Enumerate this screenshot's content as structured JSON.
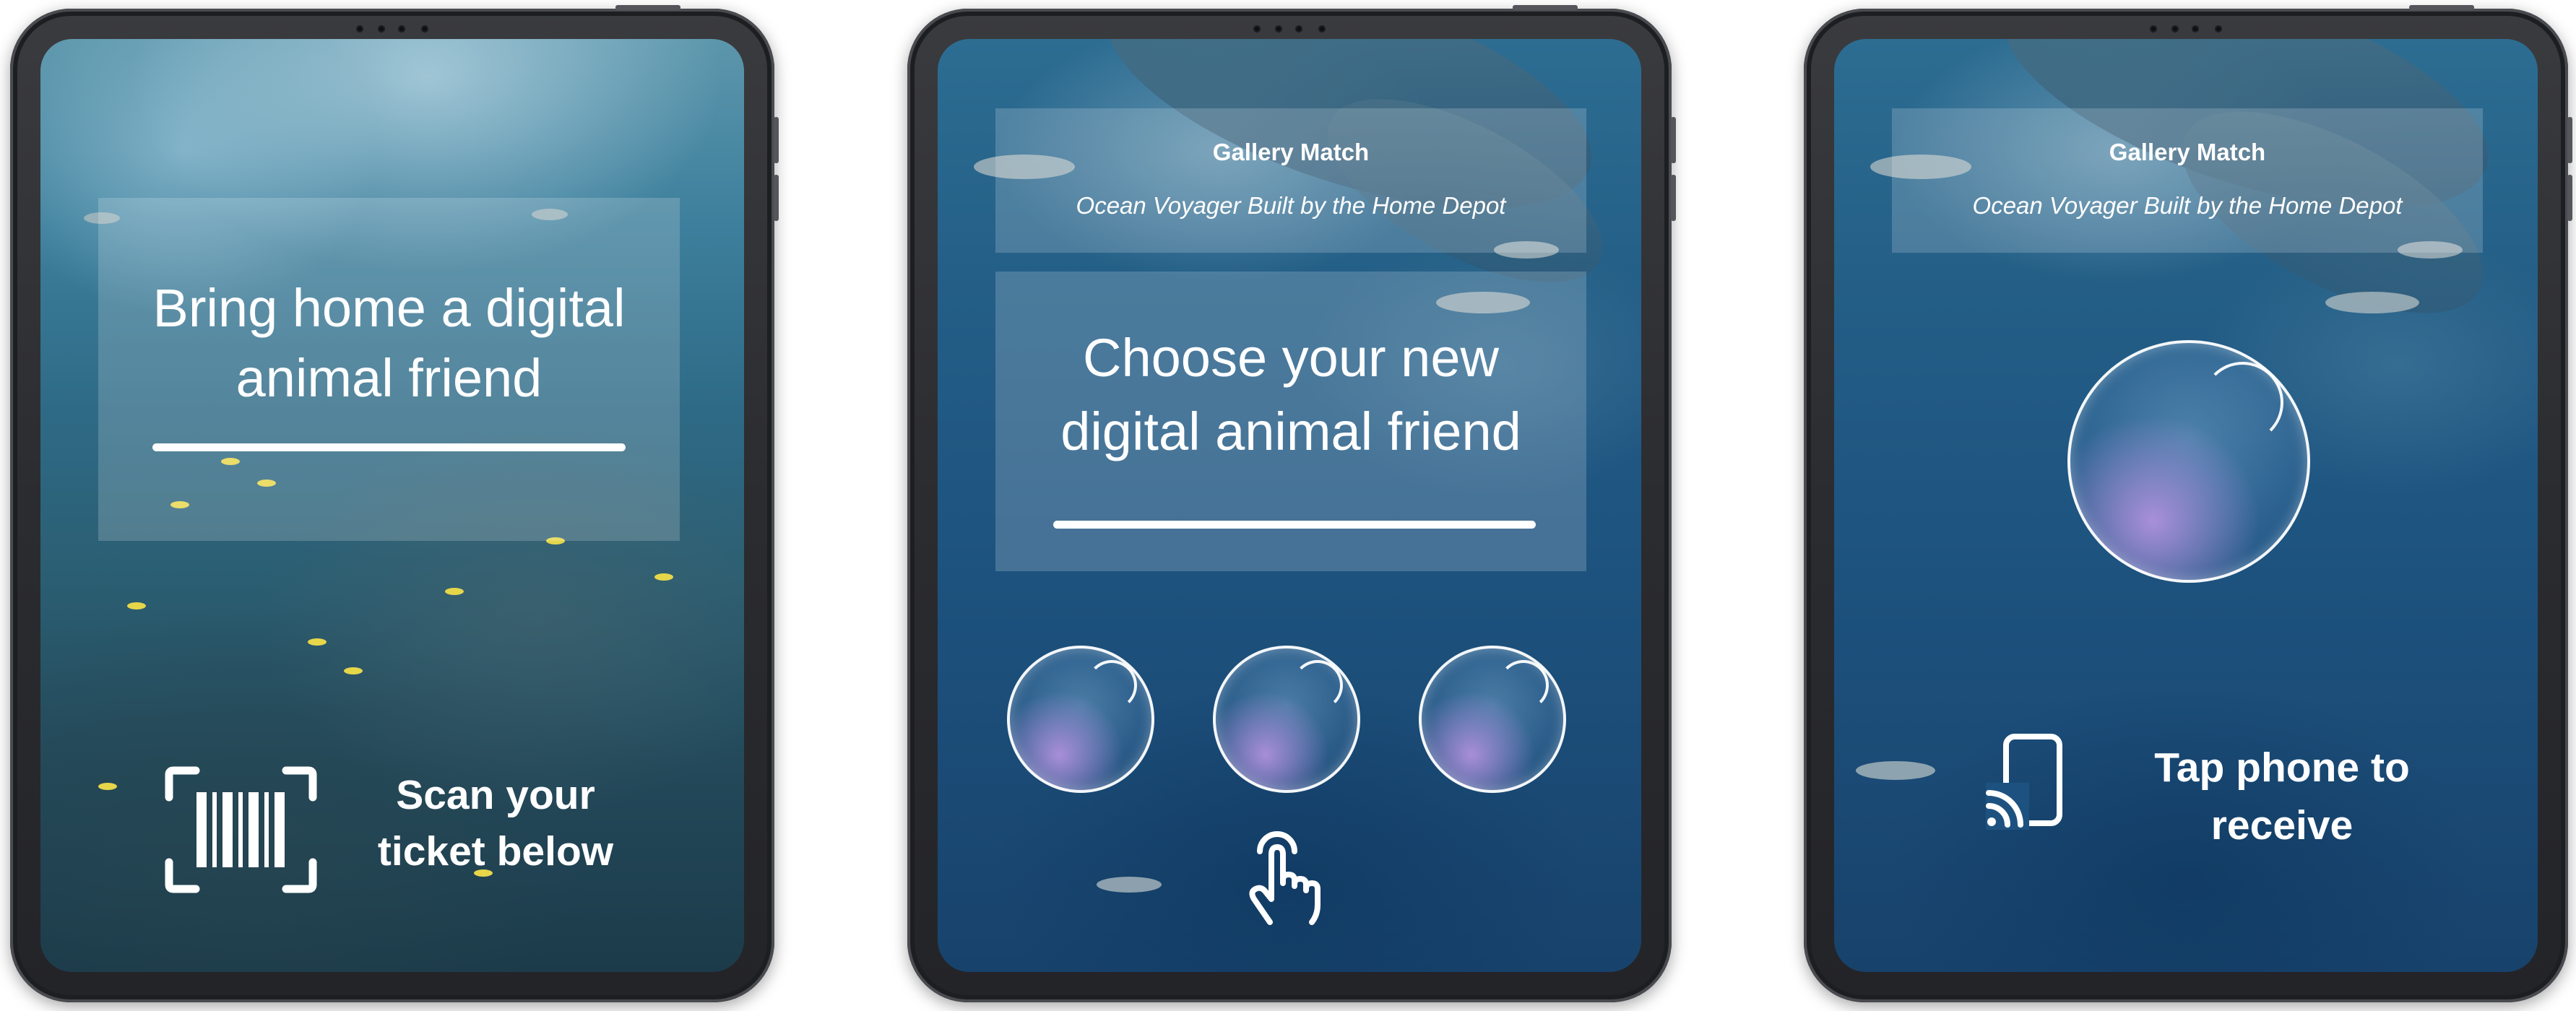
{
  "screen1": {
    "headline": [
      "Bring home a digital",
      "animal friend"
    ],
    "action": [
      "Scan your",
      "ticket below"
    ],
    "icon": "barcode-scan-icon"
  },
  "screen2": {
    "gallery_label": "Gallery Match",
    "gallery_name": "Ocean Voyager Built by the Home Depot",
    "headline": [
      "Choose your new",
      "digital animal friend"
    ],
    "bubbles": 3,
    "icon": "tap-hand-icon"
  },
  "screen3": {
    "gallery_label": "Gallery Match",
    "gallery_name": "Ocean Voyager Built by the Home Depot",
    "action": [
      "Tap phone to",
      "receive"
    ],
    "icon": "phone-nfc-icon"
  },
  "colors": {
    "text": "#ffffff",
    "panel": "rgba(255,255,255,0.18)",
    "reef_water": "#2e6a86",
    "tank_water": "#1e5581",
    "bezel": "#2b2c30"
  }
}
